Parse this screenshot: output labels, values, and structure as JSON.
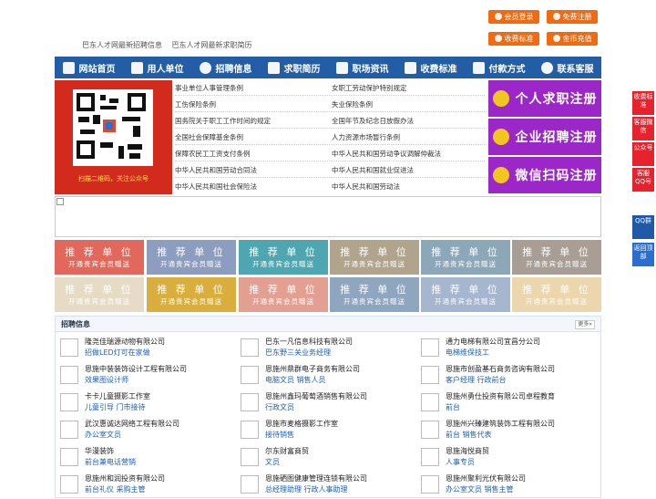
{
  "top_buttons": {
    "member_login": "会员登录",
    "free_register": "免费注册",
    "fee_standard": "收费标准",
    "gold_recharge": "金币充值"
  },
  "top_links": [
    "巴东人才网最新招聘信息",
    "巴东人才网最新求职简历"
  ],
  "nav": [
    {
      "label": "网站首页",
      "icon": "home-icon"
    },
    {
      "label": "用人单位",
      "icon": "building-icon"
    },
    {
      "label": "招聘信息",
      "icon": "megaphone-icon"
    },
    {
      "label": "求职简历",
      "icon": "resume-icon"
    },
    {
      "label": "职场资讯",
      "icon": "news-icon"
    },
    {
      "label": "收费标准",
      "icon": "price-icon"
    },
    {
      "label": "付款方式",
      "icon": "payment-icon"
    },
    {
      "label": "联系客服",
      "icon": "phone-icon"
    }
  ],
  "qr_caption": "扫描二维码，关注公众号",
  "law_links_left": [
    "事业单位人事管理条例",
    "工伤保险条例",
    "国务院关于职工工作时间的规定",
    "全国社会保障基金条例",
    "保障农民工工资支付条例",
    "中华人民共和国劳动合同法",
    "中华人民共和国社会保险法"
  ],
  "law_links_right": [
    "女职工劳动保护特别规定",
    "失业保险条例",
    "全国年节及纪念日放假办法",
    "人力资源市场暂行条例",
    "中华人民共和国劳动争议调解仲裁法",
    "中华人民共和国就业促进法",
    "中华人民共和国劳动法"
  ],
  "register_buttons": [
    "个人求职注册",
    "企业招聘注册",
    "微信扫码注册"
  ],
  "recommend": {
    "title": "推 荐 单 位",
    "subtitle": "开通贵宾会员赠送",
    "colors": [
      "#e1685a",
      "#8d9dc0",
      "#4ea6b0",
      "#b1a48c",
      "#8ca8b8",
      "#a89e96",
      "#e6dcc6",
      "#d9ae3c",
      "#e3a092",
      "#8fa6bf",
      "#a5b6ce",
      "#ecd6ae"
    ]
  },
  "sidebar": [
    "收费标准",
    "客服微信",
    "公众号",
    "客服QQ号",
    "QQ群",
    "返回顶部"
  ],
  "jobs_section": {
    "title": "招聘信息",
    "more": "更多»",
    "items": [
      {
        "company": "隆尧佳瑞源动物有限公司",
        "position": "招做LED灯可在家做"
      },
      {
        "company": "巴东一凡信息科技有限公司",
        "position": "巴东野三关业务经理"
      },
      {
        "company": "通力电梯有限公司宜昌分公司",
        "position": "电梯维保技工"
      },
      {
        "company": "恩施中装装饰设计工程有限公司",
        "position": "效果图设计师"
      },
      {
        "company": "恩施州鼎群电子商务有限公司",
        "position": "电脑文员 销售人员"
      },
      {
        "company": "恩施市创盈基石商务咨询有限公司",
        "position": "客户经理 行政前台"
      },
      {
        "company": "卡卡儿童摄影工作室",
        "position": "儿童引导 门市接待"
      },
      {
        "company": "恩施州鑫玛葡萄酒销售有限公司",
        "position": "行政文员"
      },
      {
        "company": "恩施州勇仕投资有限公司卓程教育",
        "position": "前台"
      },
      {
        "company": "武汉惠诚达网络工程有限公司",
        "position": "办公室文员"
      },
      {
        "company": "恩施市麦格摄影工作室",
        "position": "接待销售"
      },
      {
        "company": "恩施州兴臻建筑装饰工程有限公司",
        "position": "前台 销售代表"
      },
      {
        "company": "华漫装饰",
        "position": "前台兼电话营销"
      },
      {
        "company": "尔东财富商贸",
        "position": "文员"
      },
      {
        "company": "恩施海悦商贸",
        "position": "人事专员"
      },
      {
        "company": "恩施州和润投资有限公司",
        "position": "前台礼仪 采购主管"
      },
      {
        "company": "恩施硒图健康管理连锁有限公司",
        "position": "总经理助理 行政人事助理"
      },
      {
        "company": "恩施州聚利光伏有限公司",
        "position": "办公室文员 销售主管"
      }
    ]
  },
  "colors": {
    "nav": "#235da6",
    "accent": "#ef6a10",
    "purple": "#9b27c9",
    "side": "#e6232d"
  }
}
